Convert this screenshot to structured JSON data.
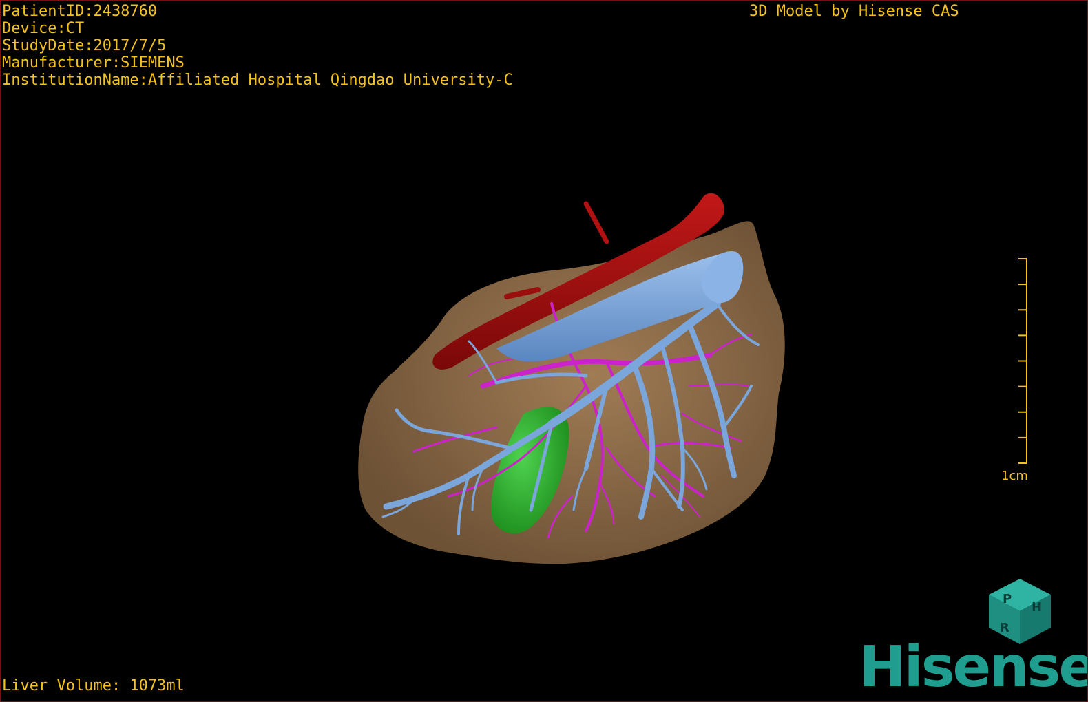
{
  "overlay": {
    "patient_id": "PatientID:2438760",
    "device": "Device:CT",
    "study_date": "StudyDate:2017/7/5",
    "manufacturer": "Manufacturer:SIEMENS",
    "institution": "InstitutionName:Affiliated Hospital Qingdao University-C",
    "title": "3D Model by Hisense CAS",
    "liver_volume": "Liver Volume: 1073ml"
  },
  "scale_bar": {
    "label": "1cm",
    "ticks": 9
  },
  "orientation_cube": {
    "faces": [
      "P",
      "H",
      "R"
    ]
  },
  "brand": {
    "name": "Hisense"
  },
  "colors": {
    "text": "#f4c21a",
    "liver": "#8b6a46",
    "artery": "#a81010",
    "portal_vein": "#6f9fd8",
    "hepatic_vessels": "#cc22cc",
    "gallbladder": "#2bb52b",
    "brand": "#1f9e8f"
  }
}
